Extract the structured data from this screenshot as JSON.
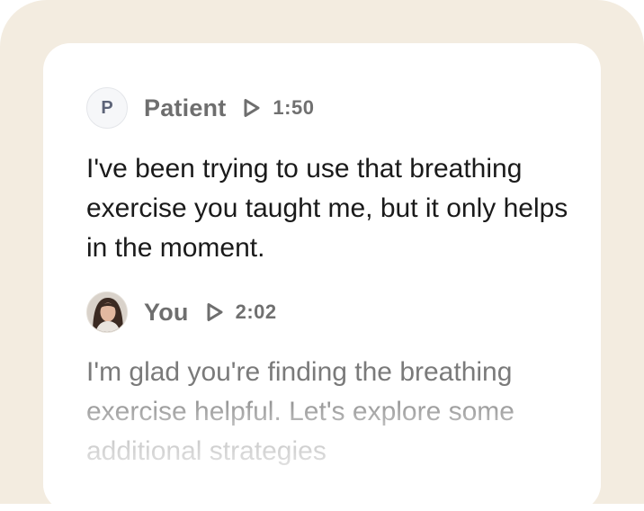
{
  "messages": {
    "patient": {
      "avatar_initial": "P",
      "name": "Patient",
      "play_icon": "play-icon",
      "time": "1:50",
      "text": "I've been trying to use that breathing exercise you taught me, but it only helps in the moment."
    },
    "you": {
      "avatar_icon": "user-photo-avatar",
      "name": "You",
      "play_icon": "play-icon",
      "time": "2:02",
      "text": "I'm glad you're finding the breathing exercise helpful. Let's explore some additional strategies"
    }
  },
  "colors": {
    "background": "#f3ece0",
    "card": "#ffffff",
    "primary_text": "#1a1a1a",
    "muted_text": "#707070"
  }
}
